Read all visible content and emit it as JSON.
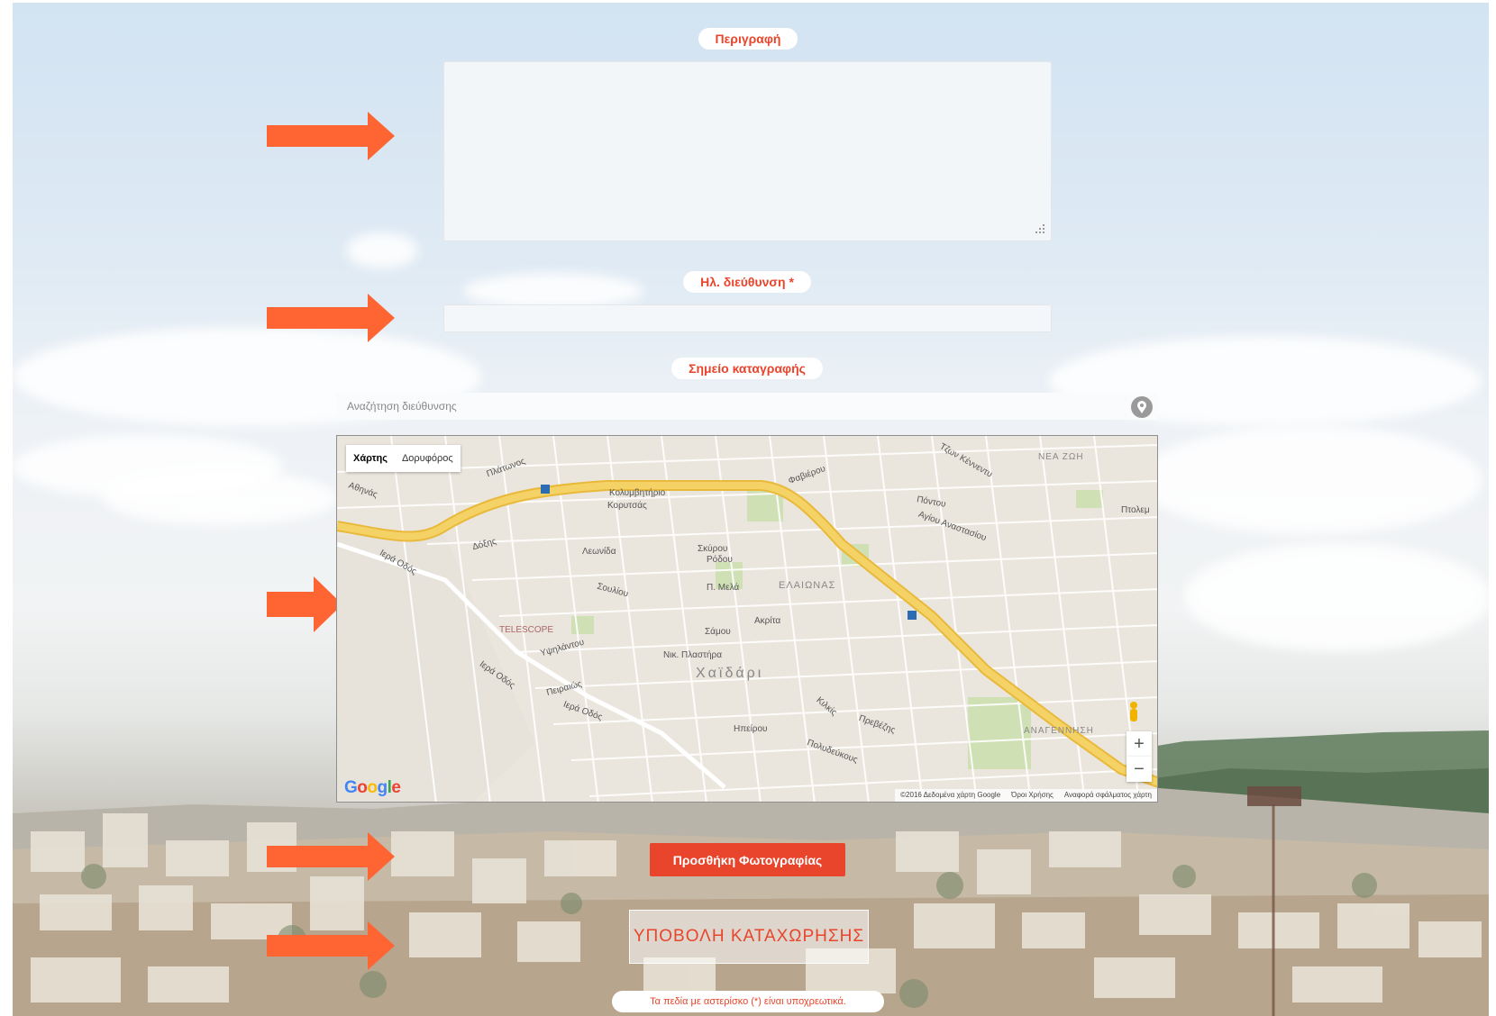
{
  "form": {
    "description_label": "Περιγραφή",
    "email_label": "Ηλ. διεύθυνση *",
    "location_label": "Σημείο καταγραφής",
    "address_search_placeholder": "Αναζήτηση διεύθυνσης",
    "add_photo_label": "Προσθήκη Φωτογραφίας",
    "submit_label": "ΥΠΟΒΟΛΗ ΚΑΤΑΧΩΡΗΣΗΣ",
    "required_note": "Τα πεδία με αστερίσκο (*) είναι υποχρεωτικά."
  },
  "map": {
    "tab_map": "Χάρτης",
    "tab_satellite": "Δορυφόρος",
    "zoom_in": "+",
    "zoom_out": "−",
    "google": "Google",
    "footer_data": "©2016 Δεδομένα χάρτη Google",
    "footer_terms": "Όροι Χρήσης",
    "footer_report": "Αναφορά σφάλματος χάρτη",
    "labels": {
      "kolymvitirio": "Κολυμβητήριο",
      "korytsas": "Κορυτσάς",
      "iera_odos": "Ιερά Οδός",
      "iera_odos_2": "Ιερά Οδός",
      "iera_odos_3": "Ιερά Οδός",
      "dozis": "Δόξης",
      "leonida": "Λεωνίδα",
      "skyrou": "Σκύρου",
      "rodou": "Ρόδου",
      "p_mela": "Π. Μελά",
      "samou": "Σάμου",
      "akrita": "Ακρίτα",
      "elaionas": "ΕΛΑΙΩΝΑΣ",
      "chaidari": "Χαϊδάρι",
      "telescope": "TELESCOPE",
      "nik_plastira": "Νικ. Πλαστήρα",
      "ypsilantou": "Υψηλάντου",
      "peiraios": "Πειραιώς",
      "ipeirou": "Ηπείρου",
      "polydefkous": "Πολυδεύκους",
      "kilkis": "Κιλκίς",
      "prevezis": "Πρεβέζης",
      "agiou_anastasiou": "Αγίου Αναστασίου",
      "pontou": "Πόντου",
      "fovierou": "Φαβιέρου",
      "nea_zoi": "ΝΕΑ ΖΩΗ",
      "anagennisi": "ΑΝΑΓΕΝΝΗΣΗ",
      "tzon_kennenty": "Τζων Κέννεντυ",
      "ptolemaidos": "Πτολεμ",
      "athinas": "Αθηνάς",
      "platonos": "Πλάτωνος",
      "soulou": "Σουλίου"
    }
  },
  "colors": {
    "accent": "#e8452c",
    "arrow": "#ff6533",
    "highway": "#f5c842",
    "road": "#ffffff"
  }
}
